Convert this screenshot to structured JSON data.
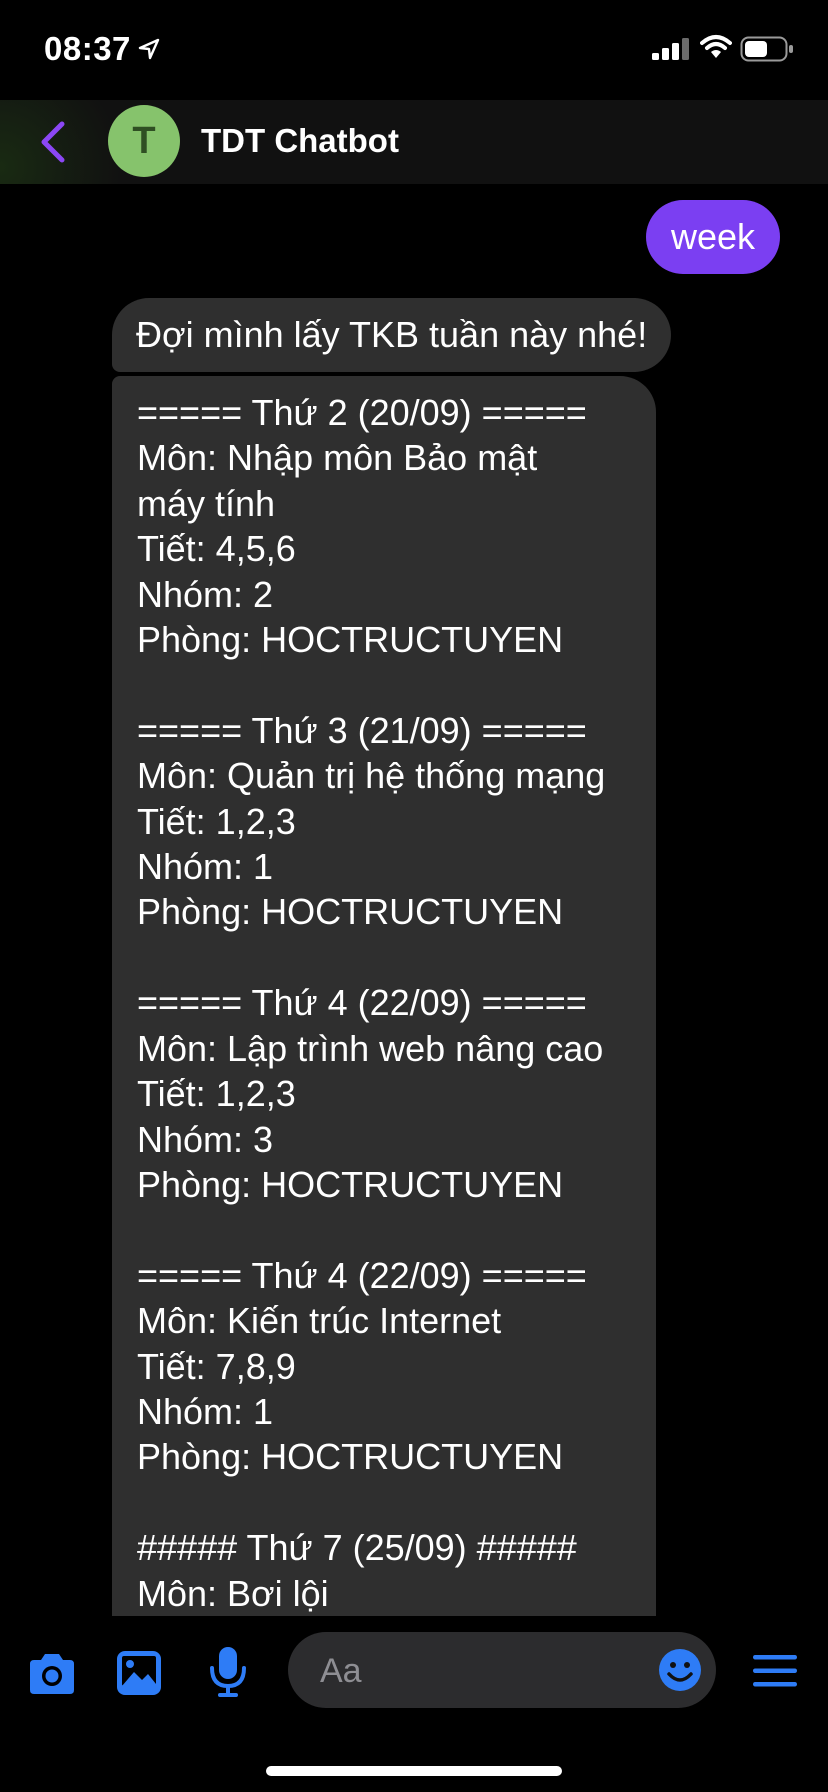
{
  "status_bar": {
    "time": "08:37"
  },
  "header": {
    "avatar_letter": "T",
    "title": "TDT Chatbot"
  },
  "messages": {
    "user_message": "week",
    "bot_message_1": "Đợi mình lấy TKB tuần này nhé!",
    "bot_message_2": "===== Thứ 2 (20/09) =====\nMôn: Nhập môn Bảo mật\nmáy tính\nTiết: 4,5,6\nNhóm: 2\nPhòng: HOCTRUCTUYEN\n\n===== Thứ 3 (21/09) =====\nMôn: Quản trị hệ thống mạng\nTiết: 1,2,3\nNhóm: 1\nPhòng: HOCTRUCTUYEN\n\n===== Thứ 4 (22/09) =====\nMôn: Lập trình web nâng cao\nTiết: 1,2,3\nNhóm: 3\nPhòng: HOCTRUCTUYEN\n\n===== Thứ 4 (22/09) =====\nMôn: Kiến trúc Internet\nTiết: 7,8,9\nNhóm: 1\nPhòng: HOCTRUCTUYEN\n\n##### Thứ 7 (25/09) #####\nMôn: Bơi lội"
  },
  "composer": {
    "placeholder": "Aa"
  },
  "colors": {
    "accent": "#7b3ff2",
    "icon_blue": "#2e7cf6",
    "bot_bubble": "#2f2f2f",
    "avatar": "#86c36c"
  },
  "icons": [
    "location-arrow-icon",
    "signal-icon",
    "wifi-icon",
    "battery-icon",
    "back-chevron-icon",
    "camera-icon",
    "photo-icon",
    "microphone-icon",
    "emoji-icon",
    "menu-icon"
  ]
}
